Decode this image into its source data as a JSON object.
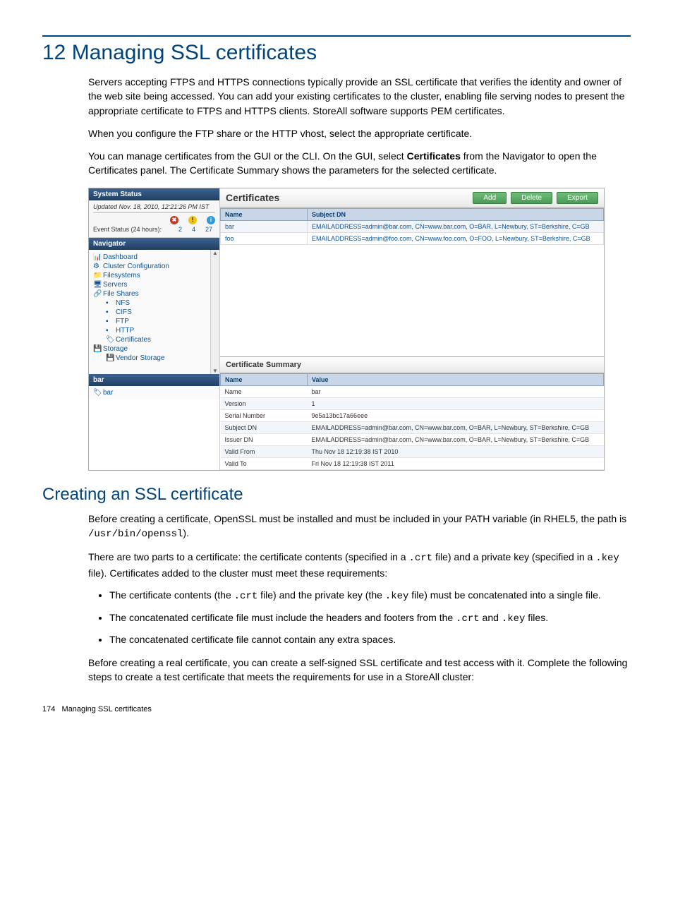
{
  "chapter": {
    "number": "12",
    "title": "Managing SSL certificates"
  },
  "paragraphs": {
    "p1": "Servers accepting FTPS and HTTPS connections typically provide an SSL certificate that verifies the identity and owner of the web site being accessed. You can add your existing certificates to the cluster, enabling file serving nodes to present the appropriate certificate to FTPS and HTTPS clients. StoreAll software supports PEM certificates.",
    "p2": "When you configure the FTP share or the HTTP vhost, select the appropriate certificate.",
    "p3a": "You can manage certificates from the GUI or the CLI. On the GUI, select ",
    "p3b": "Certificates",
    "p3c": " from the Navigator to open the Certificates panel. The Certificate Summary shows the parameters for the selected certificate."
  },
  "section2": {
    "title": "Creating an SSL certificate",
    "p1a": "Before creating a certificate, OpenSSL must be installed and must be included in your PATH variable (in RHEL5, the path is ",
    "p1code": "/usr/bin/openssl",
    "p1b": ").",
    "p2a": "There are two parts to a certificate: the certificate contents (specified in a ",
    "p2code1": ".crt",
    "p2b": " file) and a private key (specified in a ",
    "p2code2": ".key",
    "p2c": " file). Certificates added to the cluster must meet these requirements:",
    "bullets": {
      "b1a": "The certificate contents (the ",
      "b1code1": ".crt",
      "b1b": " file) and the private key (the ",
      "b1code2": ".key",
      "b1c": " file) must be concatenated into a single file.",
      "b2a": "The concatenated certificate file must include the headers and footers from the ",
      "b2code1": ".crt",
      "b2b": " and ",
      "b2code2": ".key",
      "b2c": " files.",
      "b3": "The concatenated certificate file cannot contain any extra spaces."
    },
    "p3": "Before creating a real certificate, you can create a self-signed SSL certificate and test access with it. Complete the following steps to create a test certificate that meets the requirements for use in a StoreAll cluster:"
  },
  "screenshot": {
    "status": {
      "header": "System Status",
      "updated": "Updated Nov. 18, 2010, 12:21:26 PM IST",
      "event_label": "Event Status (24 hours):",
      "counts": {
        "err": "2",
        "warn": "4",
        "info": "27"
      }
    },
    "navigator": {
      "header": "Navigator",
      "items": [
        "Dashboard",
        "Cluster Configuration",
        "Filesystems",
        "Servers",
        "File Shares",
        "NFS",
        "CIFS",
        "FTP",
        "HTTP",
        "Certificates",
        "Storage",
        "Vendor Storage"
      ]
    },
    "selected_panel_header": "bar",
    "selected_item": "bar",
    "certs": {
      "title": "Certificates",
      "buttons": {
        "add": "Add",
        "delete": "Delete",
        "export": "Export"
      },
      "columns": {
        "name": "Name",
        "subject": "Subject DN"
      },
      "rows": [
        {
          "name": "bar",
          "subject": "EMAILADDRESS=admin@bar.com, CN=www.bar.com, O=BAR, L=Newbury, ST=Berkshire, C=GB"
        },
        {
          "name": "foo",
          "subject": "EMAILADDRESS=admin@foo.com, CN=www.foo.com, O=FOO, L=Newbury, ST=Berkshire, C=GB"
        }
      ]
    },
    "summary": {
      "title": "Certificate Summary",
      "columns": {
        "name": "Name",
        "value": "Value"
      },
      "rows": [
        {
          "n": "Name",
          "v": "bar"
        },
        {
          "n": "Version",
          "v": "1"
        },
        {
          "n": "Serial Number",
          "v": "9e5a13bc17a66eee"
        },
        {
          "n": "Subject DN",
          "v": "EMAILADDRESS=admin@bar.com, CN=www.bar.com, O=BAR, L=Newbury, ST=Berkshire, C=GB"
        },
        {
          "n": "Issuer DN",
          "v": "EMAILADDRESS=admin@bar.com, CN=www.bar.com, O=BAR, L=Newbury, ST=Berkshire, C=GB"
        },
        {
          "n": "Valid From",
          "v": "Thu Nov 18 12:19:38 IST 2010"
        },
        {
          "n": "Valid To",
          "v": "Fri Nov 18 12:19:38 IST 2011"
        }
      ]
    }
  },
  "footer": {
    "page": "174",
    "label": "Managing SSL certificates"
  }
}
